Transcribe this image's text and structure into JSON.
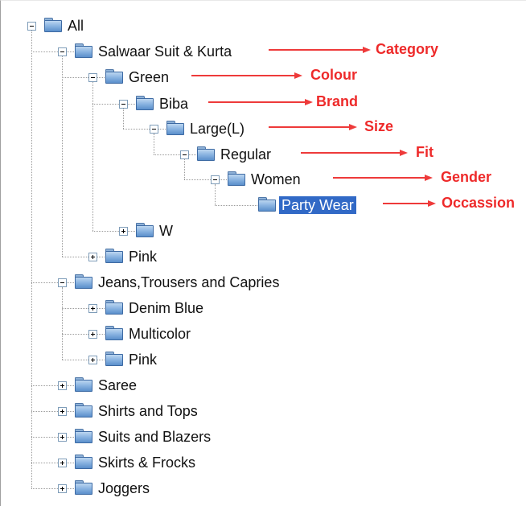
{
  "tree": {
    "nodes": [
      {
        "label": "All",
        "expanded": true,
        "selected": false
      },
      {
        "label": "Salwaar Suit & Kurta",
        "expanded": true,
        "selected": false
      },
      {
        "label": "Green",
        "expanded": true,
        "selected": false
      },
      {
        "label": "Biba",
        "expanded": true,
        "selected": false
      },
      {
        "label": "Large(L)",
        "expanded": true,
        "selected": false
      },
      {
        "label": "Regular",
        "expanded": true,
        "selected": false
      },
      {
        "label": "Women",
        "expanded": true,
        "selected": false
      },
      {
        "label": "Party Wear",
        "expanded": null,
        "selected": true
      },
      {
        "label": "W",
        "expanded": false,
        "selected": false
      },
      {
        "label": "Pink",
        "expanded": false,
        "selected": false
      },
      {
        "label": "Jeans,Trousers and Capries",
        "expanded": true,
        "selected": false
      },
      {
        "label": "Denim Blue",
        "expanded": false,
        "selected": false
      },
      {
        "label": "Multicolor",
        "expanded": false,
        "selected": false
      },
      {
        "label": "Pink",
        "expanded": false,
        "selected": false
      },
      {
        "label": "Saree",
        "expanded": false,
        "selected": false
      },
      {
        "label": "Shirts and Tops",
        "expanded": false,
        "selected": false
      },
      {
        "label": "Suits and Blazers",
        "expanded": false,
        "selected": false
      },
      {
        "label": "Skirts & Frocks",
        "expanded": false,
        "selected": false
      },
      {
        "label": "Joggers",
        "expanded": false,
        "selected": false
      }
    ]
  },
  "annotations": [
    {
      "text": "Category"
    },
    {
      "text": "Colour"
    },
    {
      "text": "Brand"
    },
    {
      "text": "Size"
    },
    {
      "text": "Fit"
    },
    {
      "text": "Gender"
    },
    {
      "text": "Occassion"
    }
  ],
  "colors": {
    "annotation": "#ee2a2a",
    "selection": "#3169c6",
    "folder": "#6f9fd6"
  },
  "icons": {
    "folder": "folder-icon",
    "expand": "plus-box-icon",
    "collapse": "minus-box-icon"
  }
}
